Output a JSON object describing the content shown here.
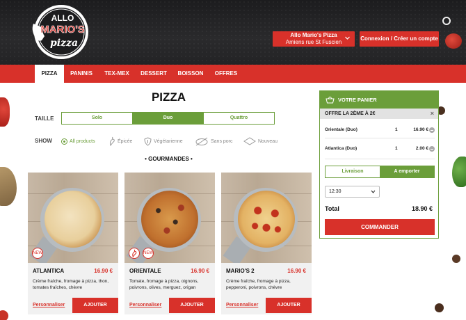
{
  "brand": {
    "logo_line1": "ALLO",
    "logo_line2": "MARIO'S",
    "logo_line3": "pizza"
  },
  "header": {
    "store_name": "Allo Mario's Pizza",
    "store_location": "Amiens rue St Fuscien",
    "login_label": "Connexion / Créer un compte"
  },
  "nav": {
    "items": [
      "PIZZA",
      "PANINIS",
      "TEX-MEX",
      "DESSERT",
      "BOISSON",
      "OFFRES"
    ],
    "active": "PIZZA"
  },
  "main": {
    "title": "PIZZA",
    "size_label": "TAILLE",
    "sizes": [
      "Solo",
      "Duo",
      "Quattro"
    ],
    "size_selected": "Duo",
    "show_label": "SHOW",
    "filters": [
      "All products",
      "Épicée",
      "Végétarienne",
      "Sans porc",
      "Nouveau"
    ],
    "section_title": "•  GOURMANDES  •"
  },
  "products": [
    {
      "name": "ATLANTICA",
      "price": "16.90 €",
      "description": "Crème fraîche, fromage à pizza, thon, tomates fraîches, chèvre",
      "customize": "Personnaliser",
      "add": "AJOUTER"
    },
    {
      "name": "ORIENTALE",
      "price": "16.90 €",
      "description": "Tomate, fromage à pizza, oignons, poivrons, olives, merguez, origan",
      "customize": "Personnaliser",
      "add": "AJOUTER"
    },
    {
      "name": "MARIO'S 2",
      "price": "16.90 €",
      "description": "Crème fraîche, fromage à pizza, pepperoni, poivrons, chèvre",
      "customize": "Personnaliser",
      "add": "AJOUTER"
    }
  ],
  "badges": {
    "new_label": "NEW",
    "spicy_label": ""
  },
  "cart": {
    "title": "VOTRE PANIER",
    "offer": "OFFRE LA 2ÈME À 2€",
    "close": "×",
    "lines": [
      {
        "name": "Orientale (Duo)",
        "qty": "1",
        "price": "16.90 €"
      },
      {
        "name": "Atlantica (Duo)",
        "qty": "1",
        "price": "2.00 €"
      }
    ],
    "modes": [
      "Livraison",
      "A emporter"
    ],
    "mode_selected": "A emporter",
    "time": "12:30",
    "total_label": "Total",
    "total_value": "18.90 €",
    "order_label": "COMMANDER"
  },
  "colors": {
    "red": "#d8312a",
    "green": "#6b9e3a",
    "dark": "#1c1c1e"
  }
}
